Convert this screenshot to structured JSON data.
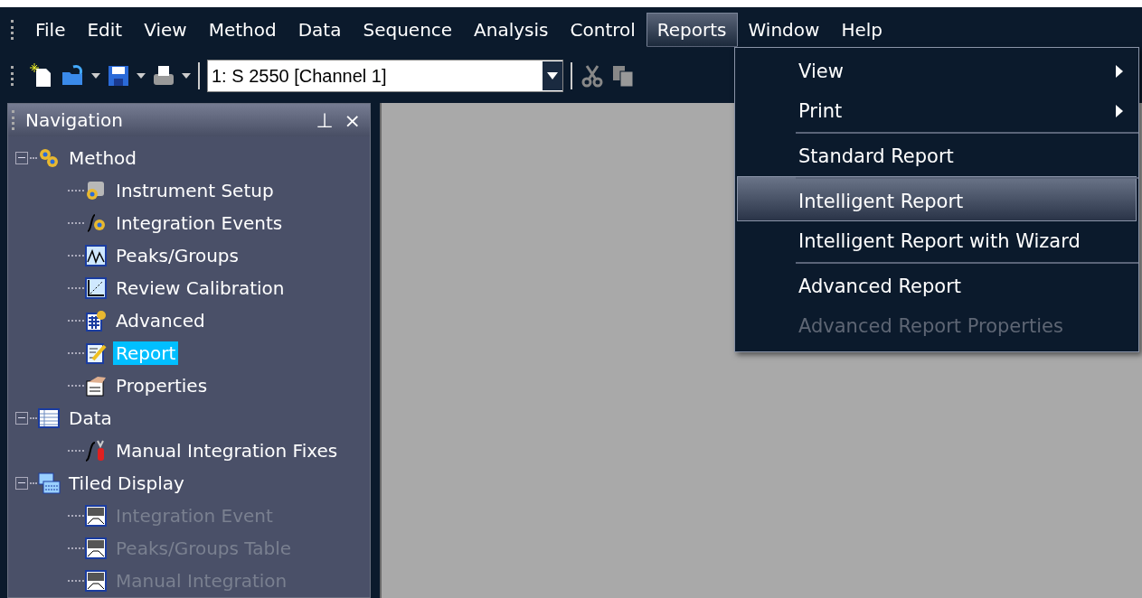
{
  "menu_bar": [
    {
      "label": "File",
      "selected": false
    },
    {
      "label": "Edit",
      "selected": false
    },
    {
      "label": "View",
      "selected": false
    },
    {
      "label": "Method",
      "selected": false
    },
    {
      "label": "Data",
      "selected": false
    },
    {
      "label": "Sequence",
      "selected": false
    },
    {
      "label": "Analysis",
      "selected": false
    },
    {
      "label": "Control",
      "selected": false
    },
    {
      "label": "Reports",
      "selected": true
    },
    {
      "label": "Window",
      "selected": false
    },
    {
      "label": "Help",
      "selected": false
    }
  ],
  "toolbar": {
    "channel_select": {
      "value": "1: S 2550 [Channel 1]"
    }
  },
  "navigation": {
    "title": "Navigation",
    "pin": "⊥",
    "close": "×",
    "tree": [
      {
        "label": "Method",
        "kind": "gears",
        "expanded": true,
        "selected": false,
        "disabled": false,
        "children": [
          {
            "label": "Instrument Setup",
            "kind": "instrument",
            "selected": false,
            "disabled": false
          },
          {
            "label": "Integration Events",
            "kind": "function",
            "selected": false,
            "disabled": false
          },
          {
            "label": "Peaks/Groups",
            "kind": "peaks",
            "selected": false,
            "disabled": false
          },
          {
            "label": "Review Calibration",
            "kind": "calibration",
            "selected": false,
            "disabled": false
          },
          {
            "label": "Advanced",
            "kind": "grid",
            "selected": false,
            "disabled": false
          },
          {
            "label": "Report",
            "kind": "report",
            "selected": true,
            "disabled": false
          },
          {
            "label": "Properties",
            "kind": "properties",
            "selected": false,
            "disabled": false
          }
        ]
      },
      {
        "label": "Data",
        "kind": "table",
        "expanded": true,
        "selected": false,
        "disabled": false,
        "children": [
          {
            "label": "Manual Integration Fixes",
            "kind": "fix",
            "selected": false,
            "disabled": false
          }
        ]
      },
      {
        "label": "Tiled Display",
        "kind": "tiles",
        "expanded": true,
        "selected": false,
        "disabled": false,
        "children": [
          {
            "label": "Integration Event",
            "kind": "tile",
            "selected": false,
            "disabled": true
          },
          {
            "label": "Peaks/Groups Table",
            "kind": "tile",
            "selected": false,
            "disabled": true
          },
          {
            "label": "Manual Integration",
            "kind": "tile",
            "selected": false,
            "disabled": true
          }
        ]
      }
    ]
  },
  "reports_menu": [
    {
      "label": "View",
      "submenu": true,
      "separator_before": false,
      "selected": false,
      "disabled": false
    },
    {
      "label": "Print",
      "submenu": true,
      "separator_before": false,
      "selected": false,
      "disabled": false
    },
    {
      "label": "Standard Report",
      "submenu": false,
      "separator_before": true,
      "selected": false,
      "disabled": false
    },
    {
      "label": "Intelligent Report",
      "submenu": false,
      "separator_before": true,
      "selected": true,
      "disabled": false
    },
    {
      "label": "Intelligent Report with Wizard",
      "submenu": false,
      "separator_before": false,
      "selected": false,
      "disabled": false
    },
    {
      "label": "Advanced Report",
      "submenu": false,
      "separator_before": true,
      "selected": false,
      "disabled": false
    },
    {
      "label": "Advanced Report Properties",
      "submenu": false,
      "separator_before": false,
      "selected": false,
      "disabled": true
    }
  ]
}
